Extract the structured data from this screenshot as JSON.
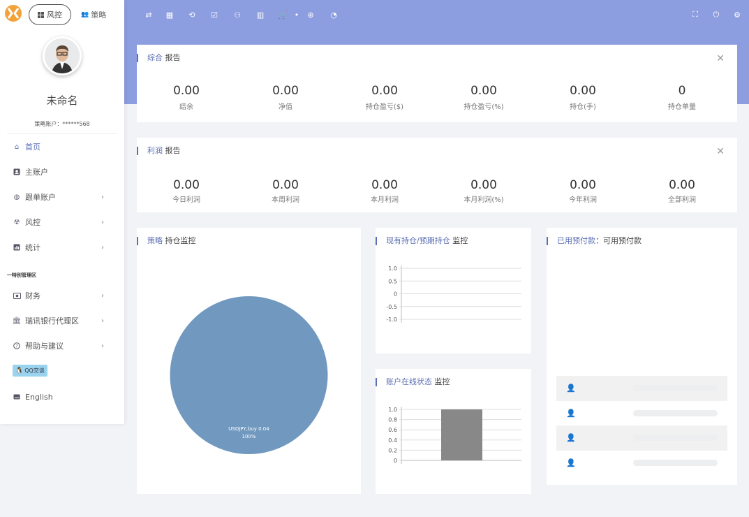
{
  "sidebar": {
    "mode_tabs": [
      {
        "label": "风控"
      },
      {
        "label": "策略"
      }
    ],
    "user": {
      "name": "未命名",
      "account": "策略账户：******568"
    },
    "items": [
      {
        "label": "首页",
        "icon": "home-icon",
        "chevron": false,
        "active": true
      },
      {
        "label": "主账户",
        "icon": "account-icon",
        "chevron": false,
        "active": false
      },
      {
        "label": "跟单账户",
        "icon": "globe-icon",
        "chevron": true,
        "active": false
      },
      {
        "label": "风控",
        "icon": "radiation-icon",
        "chevron": true,
        "active": false
      },
      {
        "label": "统计",
        "icon": "chart-icon",
        "chevron": true,
        "active": false
      }
    ],
    "section_title": "一特别管理区",
    "items2": [
      {
        "label": "财务",
        "icon": "money-icon",
        "chevron": true
      },
      {
        "label": "瑞讯银行代理区",
        "icon": "bank-icon",
        "chevron": true
      },
      {
        "label": "帮助与建议",
        "icon": "help-icon",
        "chevron": true
      }
    ],
    "qq_label": "QQ交谈",
    "language": "English"
  },
  "topbar": {
    "icons": [
      "swap-icon",
      "dashboard-icon",
      "repeat-icon",
      "checkbox-icon",
      "group-icon",
      "bar-chart-icon",
      "cart-icon",
      "dot-icon",
      "add-circle-icon",
      "pie-icon"
    ],
    "right_icons": [
      "fullscreen-icon",
      "power-icon",
      "settings-icon"
    ]
  },
  "summary_report": {
    "title_hl": "综合",
    "title_rest": " 报告",
    "stats": [
      {
        "value": "0.00",
        "label": "结余"
      },
      {
        "value": "0.00",
        "label": "净值"
      },
      {
        "value": "0.00",
        "label": "持仓盈亏($)"
      },
      {
        "value": "0.00",
        "label": "持仓盈亏(%)"
      },
      {
        "value": "0.00",
        "label": "持仓(手)"
      },
      {
        "value": "0",
        "label": "持仓单量"
      }
    ]
  },
  "profit_report": {
    "title_hl": "利润",
    "title_rest": " 报告",
    "stats": [
      {
        "value": "0.00",
        "label": "今日利润"
      },
      {
        "value": "0.00",
        "label": "本周利润"
      },
      {
        "value": "0.00",
        "label": "本月利润"
      },
      {
        "value": "0.00",
        "label": "本月利润(%)"
      },
      {
        "value": "0.00",
        "label": "今年利润"
      },
      {
        "value": "0.00",
        "label": "全部利润"
      }
    ]
  },
  "strategy_panel": {
    "title_hl": "策略",
    "title_rest": " 持仓监控"
  },
  "positions_panel": {
    "title_hl": "现有持仓/预期持仓",
    "title_rest": " 监控"
  },
  "online_panel": {
    "title_hl": "账户在线状态",
    "title_rest": " 监控"
  },
  "margin_panel": {
    "title_hl": "已用预付款",
    "title_rest": "：可用预付款",
    "rows": 4
  },
  "chart_data": [
    {
      "type": "pie",
      "slices": [
        {
          "label": "USDJPY,buy 0.04",
          "value": 100,
          "percent_label": "100%"
        }
      ],
      "colors": [
        "#7199c0"
      ]
    },
    {
      "type": "line",
      "series": [],
      "yticks": [
        "1.0",
        "0.5",
        "0",
        "-0.5",
        "-1.0"
      ],
      "ylim": [
        -1.0,
        1.0
      ]
    },
    {
      "type": "bar",
      "categories": [
        ""
      ],
      "values": [
        1.0
      ],
      "yticks": [
        "1.0",
        "0.8",
        "0.6",
        "0.4",
        "0.2",
        "0"
      ],
      "ylim": [
        0,
        1.0
      ],
      "colors": [
        "#888888"
      ]
    }
  ]
}
